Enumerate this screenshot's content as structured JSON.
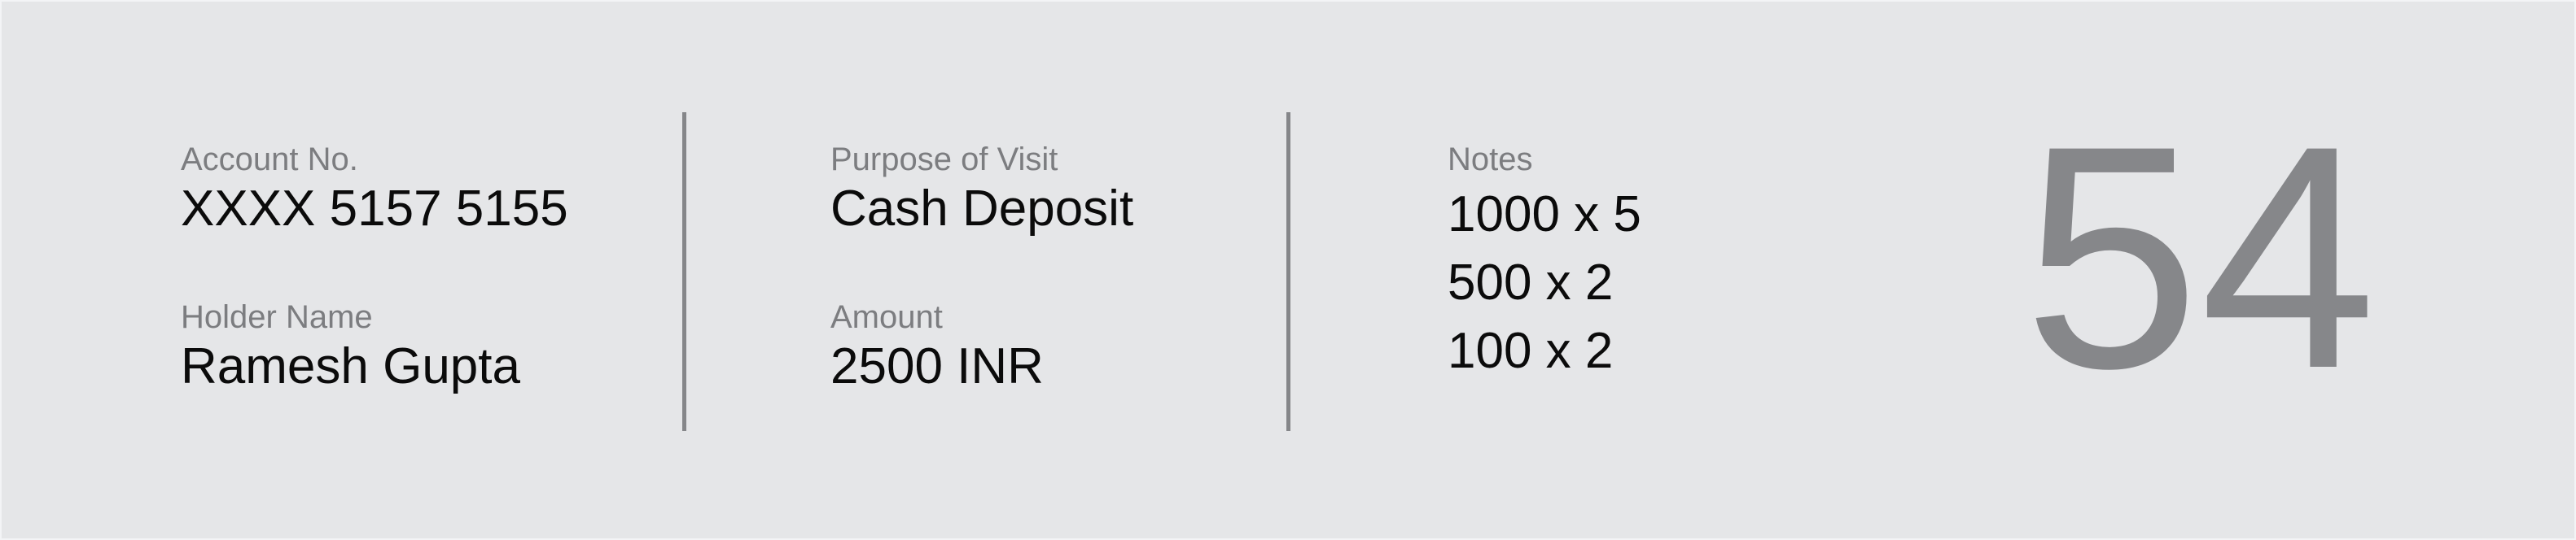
{
  "colors": {
    "background": "#e5e6e8",
    "label": "#7c7d80",
    "value": "#0b0b0b",
    "divider": "#858689",
    "token": "#86878a"
  },
  "account": {
    "label": "Account No.",
    "value": "XXXX 5157 5155"
  },
  "holder": {
    "label": "Holder Name",
    "value": "Ramesh Gupta"
  },
  "purpose": {
    "label": "Purpose of Visit",
    "value": "Cash Deposit"
  },
  "amount": {
    "label": "Amount",
    "value": "2500 INR"
  },
  "notes": {
    "label": "Notes",
    "items": [
      "1000 x 5",
      "500 x 2",
      "100 x 2"
    ]
  },
  "token": {
    "number": "54"
  }
}
